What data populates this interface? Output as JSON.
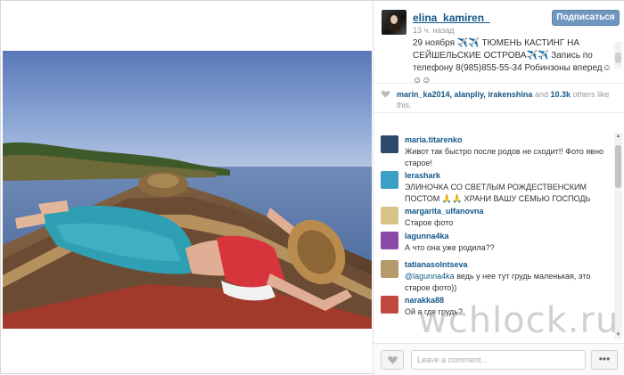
{
  "post": {
    "username": "elina_kamiren_",
    "time_ago": "13 ч. назад",
    "follow_label": "Подписаться",
    "caption": "29 ноября ✈️✈️ ТЮМЕНЬ КАСТИНГ НА СЕЙШЕЛЬСКИЕ ОСТРОВА✈️✈️ Запись по телефону 8(985)855-55-34 Робинзоны вперед☺☺☺"
  },
  "likes": {
    "users": "marin_ka2014, alanpliy, irakenshina",
    "and": "and",
    "count": "10.3k",
    "suffix": "others like this."
  },
  "comments": [
    {
      "user": "maria.titarenko",
      "text": "Живот так быстро после родов не сходит!! Фото явно старое!",
      "avatar_color": "#2d4a6b"
    },
    {
      "user": "lerashark",
      "text": "ЭЛИНОЧКА СО СВЕТЛЫМ РОЖДЕСТВЕНСКИМ ПОСТОМ 🙏🙏 ХРАНИ ВАШУ СЕМЬЮ ГОСПОДЬ",
      "avatar_color": "#3c9fc7"
    },
    {
      "user": "margarita_ulfanovna",
      "text": "Старое фото",
      "avatar_color": "#d8c48a"
    },
    {
      "user": "lagunna4ka",
      "text": "А что она уже родила??",
      "avatar_color": "#8a4aa6"
    },
    {
      "user": "tatianasolntseva",
      "mention": "@lagunna4ka",
      "text": " ведь у нее тут грудь маленькая, это старое фото))",
      "avatar_color": "#b59a6a"
    },
    {
      "user": "narakka88",
      "text": "Ой а где грудь?",
      "avatar_color": "#c0483e"
    }
  ],
  "footer": {
    "comment_placeholder": "Leave a comment...",
    "more_label": "•••"
  },
  "watermark": "wchlock.ru",
  "colors": {
    "link": "#125688",
    "follow_button": "#6f97bf"
  },
  "icons": {
    "heart": "heart-icon",
    "more": "more-options-icon"
  }
}
